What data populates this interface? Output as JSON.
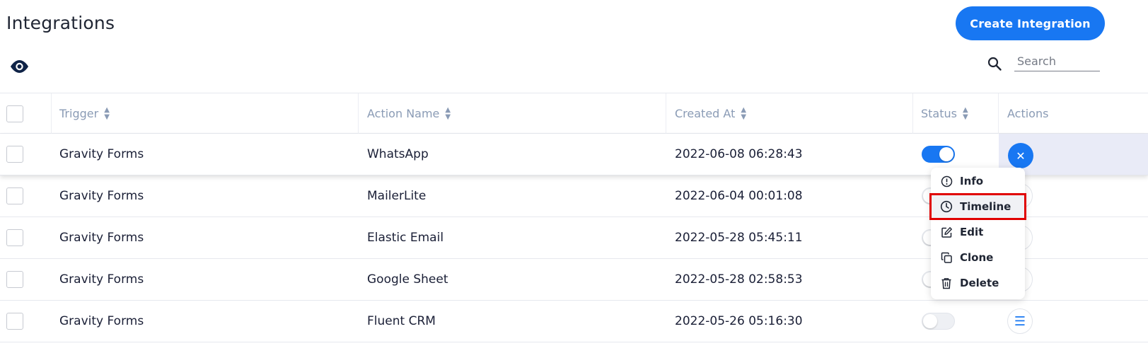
{
  "header": {
    "title": "Integrations",
    "create_button": "Create Integration"
  },
  "search": {
    "placeholder": "Search"
  },
  "table": {
    "columns": [
      "Trigger",
      "Action Name",
      "Created At",
      "Status",
      "Actions"
    ],
    "rows": [
      {
        "trigger": "Gravity Forms",
        "action": "WhatsApp",
        "created_at": "2022-06-08 06:28:43",
        "status": true
      },
      {
        "trigger": "Gravity Forms",
        "action": "MailerLite",
        "created_at": "2022-06-04 00:01:08",
        "status": false
      },
      {
        "trigger": "Gravity Forms",
        "action": "Elastic Email",
        "created_at": "2022-05-28 05:45:11",
        "status": false
      },
      {
        "trigger": "Gravity Forms",
        "action": "Google Sheet",
        "created_at": "2022-05-28 02:58:53",
        "status": false
      },
      {
        "trigger": "Gravity Forms",
        "action": "Fluent CRM",
        "created_at": "2022-05-26 05:16:30",
        "status": false
      }
    ]
  },
  "actions_menu": {
    "items": [
      "Info",
      "Timeline",
      "Edit",
      "Clone",
      "Delete"
    ],
    "highlighted": "Timeline"
  },
  "colors": {
    "accent": "#1877f2",
    "highlight_border": "#e00000",
    "header_text": "#8a9bb5"
  }
}
